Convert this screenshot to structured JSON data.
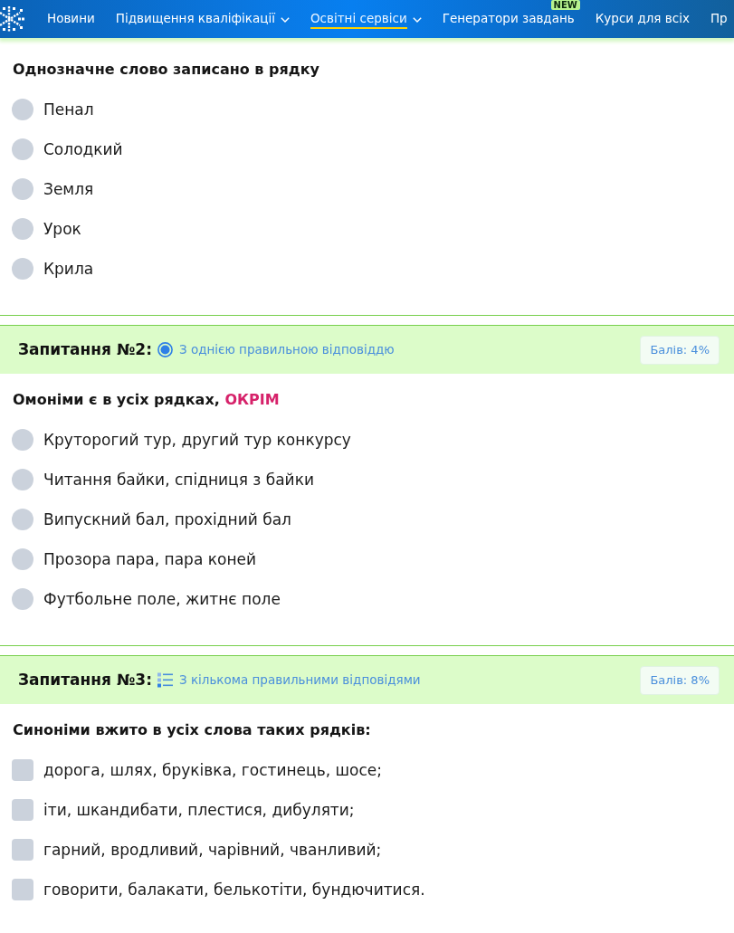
{
  "navbar": {
    "items": [
      {
        "label": "Новини",
        "selected": false,
        "has_dropdown": false
      },
      {
        "label": "Підвищення кваліфікації",
        "selected": false,
        "has_dropdown": true
      },
      {
        "label": "Освітні сервіси",
        "selected": true,
        "has_dropdown": true
      },
      {
        "label": "Генератори завдань",
        "selected": false,
        "has_dropdown": false,
        "badge": "NEW"
      },
      {
        "label": "Курси для всіх",
        "selected": false,
        "has_dropdown": false
      },
      {
        "label": "Пр",
        "selected": false,
        "has_dropdown": false
      }
    ]
  },
  "questions": [
    {
      "kind": "single",
      "prompt": "Однозначне слово записано в рядку",
      "options": [
        {
          "text": "Пенал",
          "selected": false
        },
        {
          "text": "Солодкий",
          "selected": false
        },
        {
          "text": "Земля",
          "selected": false
        },
        {
          "text": "Урок",
          "selected": false
        },
        {
          "text": "Крила",
          "selected": false
        }
      ]
    },
    {
      "kind": "single",
      "header": {
        "title": "Запитання №2:",
        "type_label": "З однією правильною відповіддю",
        "points": "Балів: 4%"
      },
      "prompt": "Омоніми є в усіх рядках, **ОКРІМ**",
      "options": [
        {
          "text": "Круторогий тур, другий тур конкурсу",
          "selected": false
        },
        {
          "text": "Читання байки, спідниця з байки",
          "selected": false
        },
        {
          "text": "Випускний бал, прохідний бал",
          "selected": false
        },
        {
          "text": "Прозора пара, пара коней",
          "selected": false
        },
        {
          "text": "Футбольне поле, житнє поле",
          "selected": false
        }
      ]
    },
    {
      "kind": "multiple",
      "header": {
        "title": "Запитання №3:",
        "type_label": "З кількома правильними відповідями",
        "points": "Балів: 8%"
      },
      "prompt": "Синоніми вжито в усіх слова таких рядків:",
      "options": [
        {
          "text": "дорога, шлях, бруківка, гостинець, шосе;",
          "checked": false
        },
        {
          "text": "іти, шкандибати, плестися, дибуляти;",
          "checked": false
        },
        {
          "text": "гарний, вродливий, чарівний, чванливий;",
          "checked": false
        },
        {
          "text": "говорити, балакати, белькотіти, бундючитися.",
          "checked": false
        }
      ]
    }
  ]
}
